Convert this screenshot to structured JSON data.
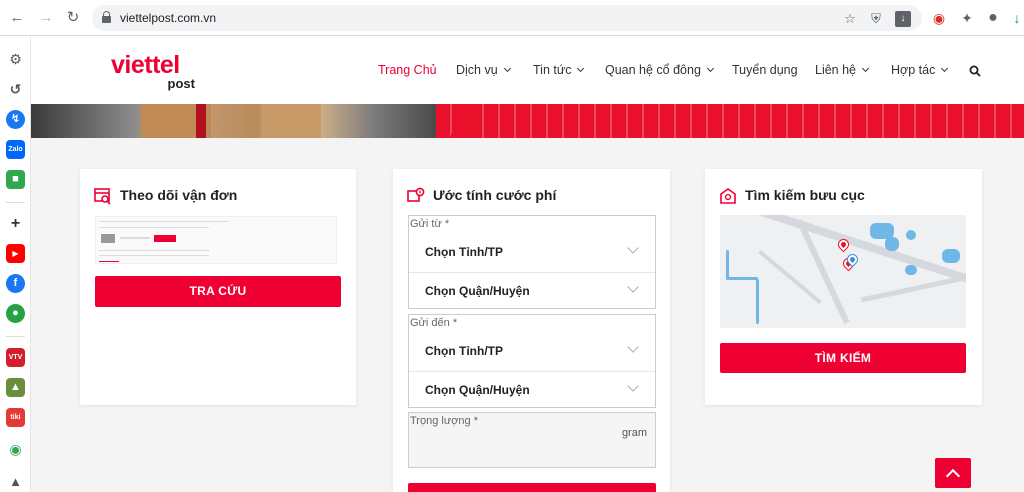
{
  "browser": {
    "url": "viettelpost.com.vn",
    "back_icon": "back-arrow-icon",
    "forward_icon": "forward-arrow-icon",
    "reload_icon": "reload-icon"
  },
  "brand": {
    "logo_main": "viettel",
    "logo_sub": "post",
    "accent_color": "#ee0033"
  },
  "nav": {
    "items": [
      {
        "label": "Trang Chủ",
        "active": true,
        "has_dropdown": false
      },
      {
        "label": "Dịch vụ",
        "active": false,
        "has_dropdown": true
      },
      {
        "label": "Tin tức",
        "active": false,
        "has_dropdown": true
      },
      {
        "label": "Quan hệ cổ đông",
        "active": false,
        "has_dropdown": true
      },
      {
        "label": "Tuyển dụng",
        "active": false,
        "has_dropdown": false
      },
      {
        "label": "Liên hệ",
        "active": false,
        "has_dropdown": true
      },
      {
        "label": "Hợp tác",
        "active": false,
        "has_dropdown": true
      }
    ],
    "search_icon": "search-icon"
  },
  "tracking": {
    "title": "Theo dõi vận đơn",
    "button": "TRA CỨU"
  },
  "estimate": {
    "title": "Ước tính cước phí",
    "from_label": "Gửi từ *",
    "to_label": "Gửi đến *",
    "province_placeholder": "Chọn Tỉnh/TP",
    "district_placeholder": "Chọn Quận/Huyện",
    "weight_label": "Trọng lượng *",
    "weight_unit": "gram"
  },
  "post_office": {
    "title": "Tìm kiếm bưu cục",
    "button": "TÌM KIẾM"
  }
}
